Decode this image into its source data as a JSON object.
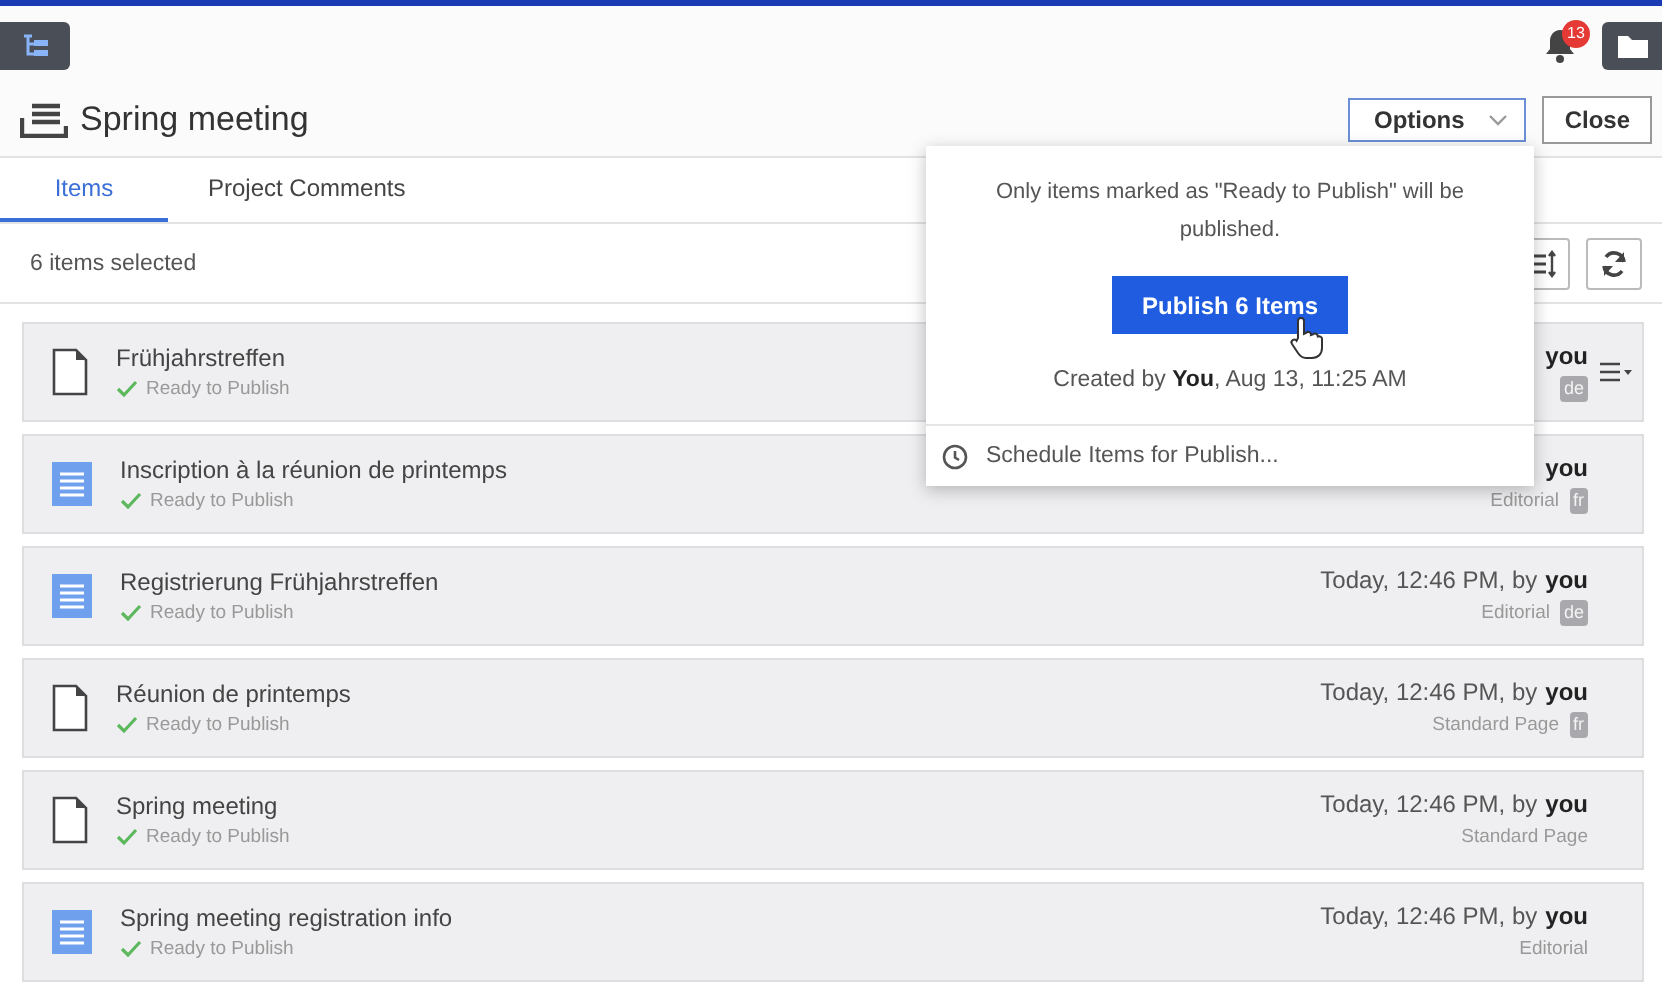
{
  "header": {
    "notification_count": "13"
  },
  "title": "Spring meeting",
  "actions": {
    "options": "Options",
    "close": "Close"
  },
  "tabs": [
    {
      "label": "Items",
      "selected": true
    },
    {
      "label": "Project Comments",
      "selected": false
    }
  ],
  "selection_count": "6 items selected",
  "rows": [
    {
      "kind": "page",
      "name": "Frühjahrstreffen",
      "status": "Ready to Publish",
      "modified_by": "you",
      "language": "de",
      "menu_visible": true
    },
    {
      "kind": "article",
      "name": "Inscription à la réunion de printemps",
      "status": "Ready to Publish",
      "modified_by": "you",
      "content_type": "Editorial",
      "language": "fr",
      "menu_visible": false
    },
    {
      "kind": "article",
      "name": "Registrierung Frühjahrstreffen",
      "status": "Ready to Publish",
      "modified": "Today, 12:46 PM, by",
      "modified_by": "you",
      "content_type": "Editorial",
      "language": "de",
      "menu_visible": false
    },
    {
      "kind": "page",
      "name": "Réunion de printemps",
      "status": "Ready to Publish",
      "modified": "Today, 12:46 PM, by",
      "modified_by": "you",
      "content_type": "Standard Page",
      "language": "fr",
      "menu_visible": false
    },
    {
      "kind": "page",
      "name": "Spring meeting",
      "status": "Ready to Publish",
      "modified": "Today, 12:46 PM, by",
      "modified_by": "you",
      "content_type": "Standard Page",
      "menu_visible": false
    },
    {
      "kind": "article",
      "name": "Spring meeting registration info",
      "status": "Ready to Publish",
      "modified": "Today, 12:46 PM, by",
      "modified_by": "you",
      "content_type": "Editorial",
      "menu_visible": false
    }
  ],
  "dropdown": {
    "note": "Only items marked as \"Ready to Publish\" will be published.",
    "publish_button": "Publish 6 Items",
    "created": "Created by **You**, Aug 13, 11:25 AM",
    "schedule": "Schedule Items for Publish..."
  }
}
